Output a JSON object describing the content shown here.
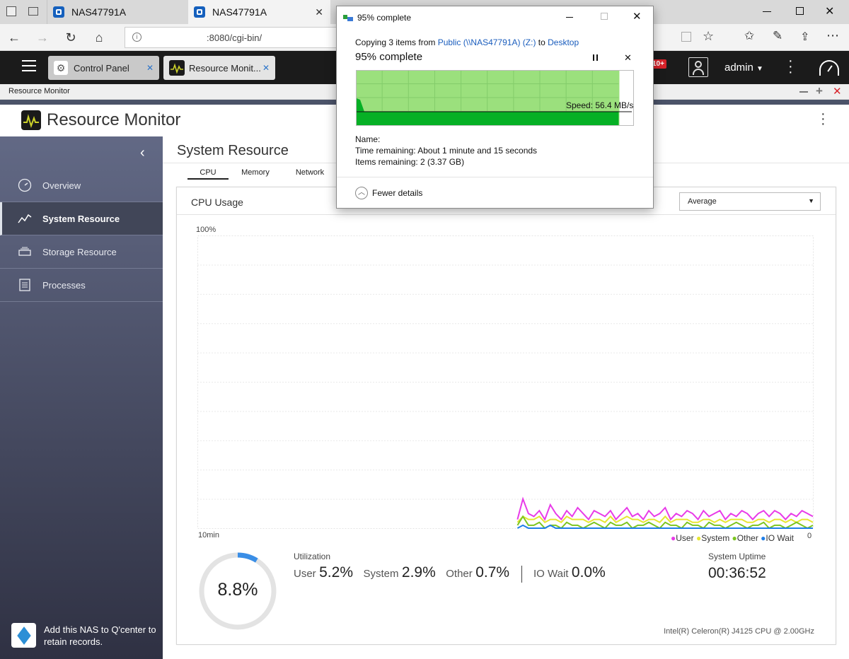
{
  "browser": {
    "tabs": [
      {
        "label": "NAS47791A"
      },
      {
        "label": "NAS47791A"
      }
    ],
    "url": ":8080/cgi-bin/"
  },
  "qts": {
    "app_tabs": [
      {
        "label": "Control Panel"
      },
      {
        "label": "Resource Monit..."
      }
    ],
    "notification_badge": "10+",
    "user": "admin"
  },
  "window_title": "Resource Monitor",
  "app": {
    "title": "Resource Monitor"
  },
  "sidebar": {
    "items": [
      {
        "label": "Overview",
        "icon": "gauge-icon"
      },
      {
        "label": "System Resource",
        "icon": "chart-line-icon"
      },
      {
        "label": "Storage Resource",
        "icon": "storage-icon"
      },
      {
        "label": "Processes",
        "icon": "list-icon"
      }
    ],
    "footer_text": "Add this NAS to Q'center to retain records."
  },
  "main": {
    "heading": "System Resource",
    "tabs": [
      {
        "label": "CPU"
      },
      {
        "label": "Memory"
      },
      {
        "label": "Network"
      }
    ],
    "panel_title": "CPU Usage",
    "dropdown_value": "Average",
    "gauge_value": "8.8%",
    "gauge_fraction": 0.088,
    "utilization_label": "Utilization",
    "util": [
      {
        "label": "User",
        "value": "5.2%"
      },
      {
        "label": "System",
        "value": "2.9%"
      },
      {
        "label": "Other",
        "value": "0.7%"
      },
      {
        "label": "IO Wait",
        "value": "0.0%"
      }
    ],
    "uptime_label": "System Uptime",
    "uptime_value": "00:36:52",
    "cpu_model": "Intel(R) Celeron(R) J4125 CPU @ 2.00GHz"
  },
  "chart_data": {
    "type": "line",
    "ylabel_top": "100%",
    "x_label_left": "10min",
    "x_label_right": "0",
    "ylim": [
      0,
      100
    ],
    "legend_position": "bottom-right",
    "series": [
      {
        "name": "User",
        "color": "#e83be8",
        "values": [
          3,
          10,
          5,
          4,
          6,
          3,
          8,
          5,
          3,
          6,
          4,
          7,
          5,
          3,
          6,
          5,
          4,
          6,
          3,
          5,
          7,
          4,
          5,
          3,
          6,
          4,
          5,
          7,
          3,
          5,
          4,
          6,
          5,
          3,
          6,
          4,
          5,
          6,
          3,
          5,
          4,
          6,
          5,
          3,
          5,
          6,
          4,
          6,
          5,
          3,
          5,
          4,
          6,
          5,
          4
        ]
      },
      {
        "name": "System",
        "color": "#e6e632",
        "values": [
          2,
          4,
          3,
          3,
          4,
          2,
          3,
          3,
          2,
          4,
          3,
          3,
          3,
          2,
          3,
          3,
          2,
          4,
          2,
          3,
          4,
          3,
          3,
          2,
          3,
          3,
          2,
          4,
          2,
          3,
          3,
          3,
          2,
          2,
          3,
          3,
          2,
          3,
          2,
          3,
          3,
          3,
          2,
          2,
          3,
          3,
          2,
          3,
          3,
          2,
          3,
          2,
          3,
          3,
          2
        ]
      },
      {
        "name": "Other",
        "color": "#7cc520",
        "values": [
          1,
          4,
          1,
          1,
          2,
          0,
          1,
          1,
          0,
          2,
          1,
          1,
          0,
          1,
          2,
          1,
          0,
          2,
          1,
          1,
          2,
          0,
          1,
          1,
          2,
          1,
          0,
          2,
          1,
          1,
          0,
          2,
          1,
          1,
          0,
          2,
          1,
          1,
          0,
          1,
          2,
          1,
          0,
          1,
          1,
          2,
          0,
          1,
          1,
          0,
          1,
          2,
          1,
          0,
          1
        ]
      },
      {
        "name": "IO Wait",
        "color": "#1e7ee8",
        "values": [
          0,
          1,
          0,
          0,
          0,
          0,
          1,
          0,
          0,
          0,
          0,
          0,
          0,
          0,
          0,
          0,
          0,
          0,
          0,
          0,
          0,
          0,
          0,
          0,
          0,
          0,
          0,
          0,
          0,
          0,
          0,
          0,
          0,
          0,
          0,
          0,
          0,
          0,
          0,
          0,
          0,
          0,
          0,
          0,
          0,
          0,
          0,
          0,
          0,
          0,
          0,
          0,
          0,
          0,
          0
        ]
      }
    ]
  },
  "copy_dialog": {
    "title": "95% complete",
    "copying_prefix": "Copying 3 items from ",
    "source": "Public (\\\\NAS47791A) (Z:)",
    "to": " to ",
    "dest": "Desktop",
    "heading": "95% complete",
    "progress_fraction": 0.95,
    "speed": "Speed: 56.4 MB/s",
    "name_label": "Name:",
    "time_remaining": "Time remaining:  About 1 minute and 15 seconds",
    "items_remaining": "Items remaining:  2 (3.37 GB)",
    "fewer_details": "Fewer details"
  },
  "colors": {
    "sidebar_top": "#626985",
    "sidebar_bottom": "#2f3143",
    "gauge_accent": "#3a8ee6",
    "progress_green": "#06b025"
  }
}
